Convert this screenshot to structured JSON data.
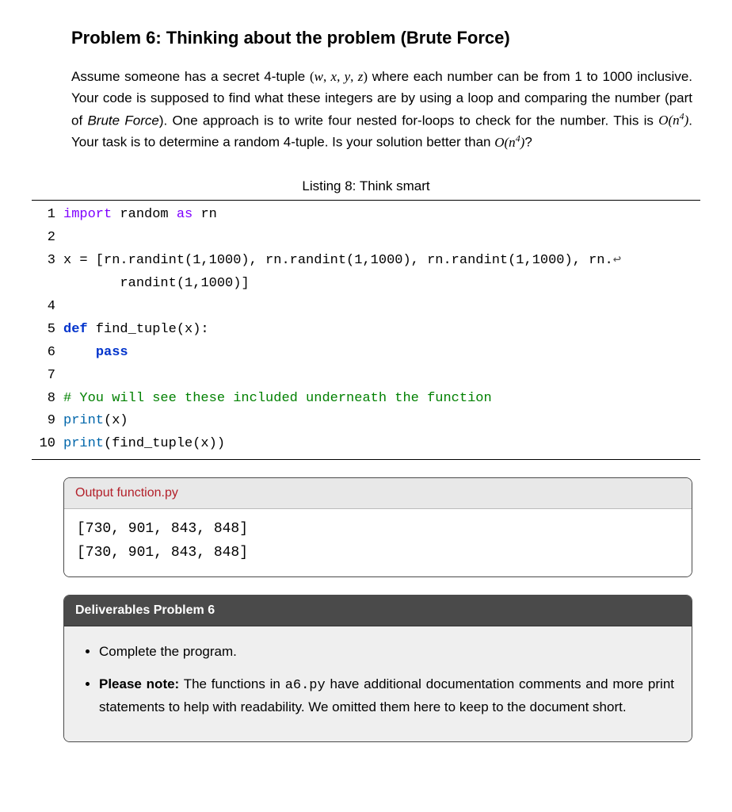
{
  "heading": "Problem 6: Thinking about the problem (Brute Force)",
  "prose": {
    "p1a": "Assume someone has a secret 4-tuple ",
    "tuple": "(w, x, y, z)",
    "p1b": " where each number can be from 1 to 1000 inclusive. Your code is supposed to find what these integers are by using a loop and comparing the number (part of ",
    "bf": "Brute Force",
    "p1c": "). One approach is to write four nested for-loops to check for the number. This is ",
    "bigO1_a": "O(n",
    "bigO1_exp": "4",
    "bigO1_b": ")",
    "p1d": ". Your task is to determine a random 4-tuple. Is your solution better than ",
    "bigO2_a": "O(n",
    "bigO2_exp": "4",
    "bigO2_b": ")",
    "p1e": "?"
  },
  "listing_caption": "Listing 8: Think smart",
  "code": {
    "lines": [
      {
        "n": "1",
        "segs": [
          {
            "t": "import",
            "c": "kw-import"
          },
          {
            "t": " random "
          },
          {
            "t": "as",
            "c": "kw-import"
          },
          {
            "t": " rn"
          }
        ]
      },
      {
        "n": "2",
        "segs": [
          {
            "t": ""
          }
        ]
      },
      {
        "n": "3",
        "segs": [
          {
            "t": "x = [rn.randint(1,1000), rn.randint(1,1000), rn.randint(1,1000), rn."
          },
          {
            "t": "↩",
            "c": "wrap-arrow"
          }
        ]
      },
      {
        "n": "",
        "segs": [
          {
            "t": "       randint(1,1000)]"
          }
        ]
      },
      {
        "n": "4",
        "segs": [
          {
            "t": ""
          }
        ]
      },
      {
        "n": "5",
        "segs": [
          {
            "t": "def",
            "c": "kw-def"
          },
          {
            "t": " find_tuple(x):"
          }
        ]
      },
      {
        "n": "6",
        "segs": [
          {
            "t": "    "
          },
          {
            "t": "pass",
            "c": "kw-pass"
          }
        ]
      },
      {
        "n": "7",
        "segs": [
          {
            "t": ""
          }
        ]
      },
      {
        "n": "8",
        "segs": [
          {
            "t": "# You will see these included underneath the function",
            "c": "cmt"
          }
        ]
      },
      {
        "n": "9",
        "segs": [
          {
            "t": "print",
            "c": "fn"
          },
          {
            "t": "(x)"
          }
        ]
      },
      {
        "n": "10",
        "segs": [
          {
            "t": "print",
            "c": "fn"
          },
          {
            "t": "(find_tuple(x))"
          }
        ]
      }
    ]
  },
  "output": {
    "title": "Output function.py",
    "lines": [
      "[730, 901, 843, 848]",
      "[730, 901, 843, 848]"
    ]
  },
  "deliverables": {
    "title": "Deliverables Problem 6",
    "items": [
      {
        "plain": "Complete the program."
      },
      {
        "bold": "Please note:",
        "rest_a": " The functions in ",
        "code": "a6.py",
        "rest_b": " have additional documentation comments and more print statements to help with readability. We omitted them here to keep to the document short."
      }
    ]
  }
}
